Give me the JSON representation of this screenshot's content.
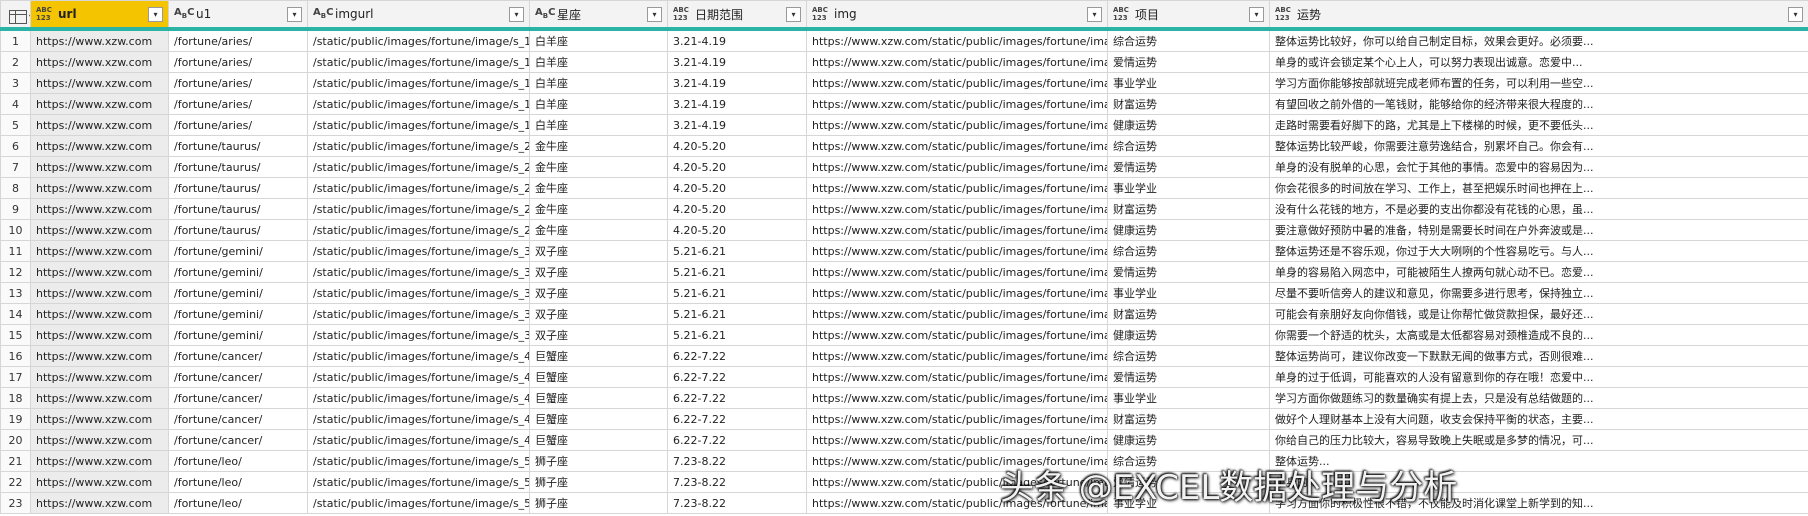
{
  "columns": [
    {
      "name": "url",
      "type": "ABC\n123",
      "selected": true
    },
    {
      "name": "u1",
      "type": "ABC",
      "selected": false
    },
    {
      "name": "imgurl",
      "type": "ABC",
      "selected": false
    },
    {
      "name": "星座",
      "type": "ABC",
      "selected": false
    },
    {
      "name": "日期范围",
      "type": "ABC\n123",
      "selected": false
    },
    {
      "name": "img",
      "type": "ABC\n123",
      "selected": false
    },
    {
      "name": "项目",
      "type": "ABC\n123",
      "selected": false
    },
    {
      "name": "运势",
      "type": "ABC\n123",
      "selected": false
    }
  ],
  "rows": [
    [
      "1",
      "https://www.xzw.com",
      "/fortune/aries/",
      "/static/public/images/fortune/image/s_1.png",
      "白羊座",
      "3.21-4.19",
      "https://www.xzw.com/static/public/images/fortune/image/s_1.png",
      "综合运势",
      "整体运势比较好，你可以给自己制定目标，效果会更好。必须要..."
    ],
    [
      "2",
      "https://www.xzw.com",
      "/fortune/aries/",
      "/static/public/images/fortune/image/s_1.png",
      "白羊座",
      "3.21-4.19",
      "https://www.xzw.com/static/public/images/fortune/image/s_1.png",
      "爱情运势",
      "单身的或许会锁定某个心上人，可以努力表现出诚意。恋爱中..."
    ],
    [
      "3",
      "https://www.xzw.com",
      "/fortune/aries/",
      "/static/public/images/fortune/image/s_1.png",
      "白羊座",
      "3.21-4.19",
      "https://www.xzw.com/static/public/images/fortune/image/s_1.png",
      "事业学业",
      "学习方面你能够按部就班完成老师布置的任务，可以利用一些空..."
    ],
    [
      "4",
      "https://www.xzw.com",
      "/fortune/aries/",
      "/static/public/images/fortune/image/s_1.png",
      "白羊座",
      "3.21-4.19",
      "https://www.xzw.com/static/public/images/fortune/image/s_1.png",
      "财富运势",
      "有望回收之前外借的一笔钱财，能够给你的经济带来很大程度的..."
    ],
    [
      "5",
      "https://www.xzw.com",
      "/fortune/aries/",
      "/static/public/images/fortune/image/s_1.png",
      "白羊座",
      "3.21-4.19",
      "https://www.xzw.com/static/public/images/fortune/image/s_1.png",
      "健康运势",
      "走路时需要看好脚下的路，尤其是上下楼梯的时候，更不要低头..."
    ],
    [
      "6",
      "https://www.xzw.com",
      "/fortune/taurus/",
      "/static/public/images/fortune/image/s_2.png",
      "金牛座",
      "4.20-5.20",
      "https://www.xzw.com/static/public/images/fortune/image/s_2.png",
      "综合运势",
      "整体运势比较严峻，你需要注意劳逸结合，别累坏自己。你会有..."
    ],
    [
      "7",
      "https://www.xzw.com",
      "/fortune/taurus/",
      "/static/public/images/fortune/image/s_2.png",
      "金牛座",
      "4.20-5.20",
      "https://www.xzw.com/static/public/images/fortune/image/s_2.png",
      "爱情运势",
      "单身的没有脱单的心思，会忙于其他的事情。恋爱中的容易因为..."
    ],
    [
      "8",
      "https://www.xzw.com",
      "/fortune/taurus/",
      "/static/public/images/fortune/image/s_2.png",
      "金牛座",
      "4.20-5.20",
      "https://www.xzw.com/static/public/images/fortune/image/s_2.png",
      "事业学业",
      "你会花很多的时间放在学习、工作上，甚至把娱乐时间也押在上..."
    ],
    [
      "9",
      "https://www.xzw.com",
      "/fortune/taurus/",
      "/static/public/images/fortune/image/s_2.png",
      "金牛座",
      "4.20-5.20",
      "https://www.xzw.com/static/public/images/fortune/image/s_2.png",
      "财富运势",
      "没有什么花钱的地方，不是必要的支出你都没有花钱的心思，虽..."
    ],
    [
      "10",
      "https://www.xzw.com",
      "/fortune/taurus/",
      "/static/public/images/fortune/image/s_2.png",
      "金牛座",
      "4.20-5.20",
      "https://www.xzw.com/static/public/images/fortune/image/s_2.png",
      "健康运势",
      "要注意做好预防中暑的准备，特别是需要长时间在户外奔波或是..."
    ],
    [
      "11",
      "https://www.xzw.com",
      "/fortune/gemini/",
      "/static/public/images/fortune/image/s_3.png",
      "双子座",
      "5.21-6.21",
      "https://www.xzw.com/static/public/images/fortune/image/s_3.png",
      "综合运势",
      "整体运势还是不容乐观，你过于大大咧咧的个性容易吃亏。与人..."
    ],
    [
      "12",
      "https://www.xzw.com",
      "/fortune/gemini/",
      "/static/public/images/fortune/image/s_3.png",
      "双子座",
      "5.21-6.21",
      "https://www.xzw.com/static/public/images/fortune/image/s_3.png",
      "爱情运势",
      "单身的容易陷入网恋中，可能被陌生人撩两句就心动不已。恋爱..."
    ],
    [
      "13",
      "https://www.xzw.com",
      "/fortune/gemini/",
      "/static/public/images/fortune/image/s_3.png",
      "双子座",
      "5.21-6.21",
      "https://www.xzw.com/static/public/images/fortune/image/s_3.png",
      "事业学业",
      "尽量不要听信旁人的建议和意见，你需要多进行思考，保持独立..."
    ],
    [
      "14",
      "https://www.xzw.com",
      "/fortune/gemini/",
      "/static/public/images/fortune/image/s_3.png",
      "双子座",
      "5.21-6.21",
      "https://www.xzw.com/static/public/images/fortune/image/s_3.png",
      "财富运势",
      "可能会有亲朋好友向你借钱，或是让你帮忙做贷款担保，最好还..."
    ],
    [
      "15",
      "https://www.xzw.com",
      "/fortune/gemini/",
      "/static/public/images/fortune/image/s_3.png",
      "双子座",
      "5.21-6.21",
      "https://www.xzw.com/static/public/images/fortune/image/s_3.png",
      "健康运势",
      "你需要一个舒适的枕头，太高或是太低都容易对颈椎造成不良的..."
    ],
    [
      "16",
      "https://www.xzw.com",
      "/fortune/cancer/",
      "/static/public/images/fortune/image/s_4.png",
      "巨蟹座",
      "6.22-7.22",
      "https://www.xzw.com/static/public/images/fortune/image/s_4.png",
      "综合运势",
      "整体运势尚可，建议你改变一下默默无闻的做事方式，否则很难..."
    ],
    [
      "17",
      "https://www.xzw.com",
      "/fortune/cancer/",
      "/static/public/images/fortune/image/s_4.png",
      "巨蟹座",
      "6.22-7.22",
      "https://www.xzw.com/static/public/images/fortune/image/s_4.png",
      "爱情运势",
      "单身的过于低调，可能喜欢的人没有留意到你的存在哦！恋爱中..."
    ],
    [
      "18",
      "https://www.xzw.com",
      "/fortune/cancer/",
      "/static/public/images/fortune/image/s_4.png",
      "巨蟹座",
      "6.22-7.22",
      "https://www.xzw.com/static/public/images/fortune/image/s_4.png",
      "事业学业",
      "学习方面你做题练习的数量确实有提上去，只是没有总结做题的..."
    ],
    [
      "19",
      "https://www.xzw.com",
      "/fortune/cancer/",
      "/static/public/images/fortune/image/s_4.png",
      "巨蟹座",
      "6.22-7.22",
      "https://www.xzw.com/static/public/images/fortune/image/s_4.png",
      "财富运势",
      "做好个人理财基本上没有大问题，收支会保持平衡的状态，主要..."
    ],
    [
      "20",
      "https://www.xzw.com",
      "/fortune/cancer/",
      "/static/public/images/fortune/image/s_4.png",
      "巨蟹座",
      "6.22-7.22",
      "https://www.xzw.com/static/public/images/fortune/image/s_4.png",
      "健康运势",
      "你给自己的压力比较大，容易导致晚上失眠或是多梦的情况，可..."
    ],
    [
      "21",
      "https://www.xzw.com",
      "/fortune/leo/",
      "/static/public/images/fortune/image/s_5.png",
      "狮子座",
      "7.23-8.22",
      "https://www.xzw.com/static/public/images/fortune/image/s_5.png",
      "综合运势",
      "整体运势..."
    ],
    [
      "22",
      "https://www.xzw.com",
      "/fortune/leo/",
      "/static/public/images/fortune/image/s_5.png",
      "狮子座",
      "7.23-8.22",
      "https://www.xzw.com/static/public/images/fortune/image/s_5.png",
      "爱情运势",
      "单身的..."
    ],
    [
      "23",
      "https://www.xzw.com",
      "/fortune/leo/",
      "/static/public/images/fortune/image/s_5.png",
      "狮子座",
      "7.23-8.22",
      "https://www.xzw.com/static/public/images/fortune/image/s_5.png",
      "事业学业",
      "学习方面你的积极性很不错，不仅能及时消化课堂上新学到的知..."
    ]
  ],
  "watermark": "头条 @EXCEL数据处理与分析",
  "colors": {
    "selected_header": "#f5c400",
    "accent_line": "#2bb4a6"
  }
}
